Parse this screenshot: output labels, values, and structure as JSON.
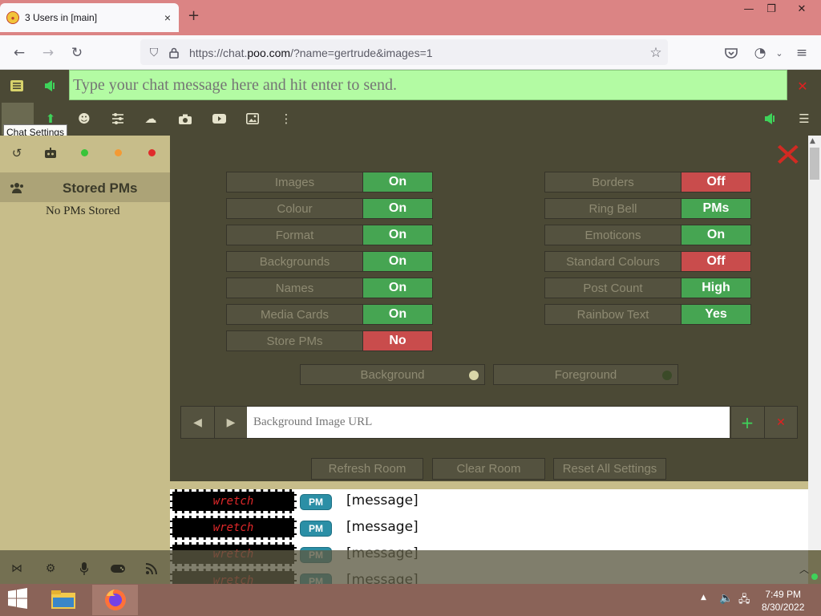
{
  "browser": {
    "tab_title": "3 Users in [main]",
    "tab_close": "×",
    "new_tab": "+",
    "url_prefix": "https://chat.",
    "url_domain": "poo.com",
    "url_rest": "/?name=gertrude&images=1",
    "window_min": "—",
    "window_restore": "❐",
    "window_close": "✕"
  },
  "chat_input": {
    "placeholder": "Type your chat message here and hit enter to send.",
    "close": "✕"
  },
  "tooltip": "Chat Settings",
  "left_panel": {
    "stored_title": "Stored PMs",
    "empty_text": "No PMs Stored"
  },
  "settings": {
    "close_label": "✕",
    "left_column": [
      {
        "label": "Images",
        "value": "On",
        "state": "on"
      },
      {
        "label": "Colour",
        "value": "On",
        "state": "on"
      },
      {
        "label": "Format",
        "value": "On",
        "state": "on"
      },
      {
        "label": "Backgrounds",
        "value": "On",
        "state": "on"
      },
      {
        "label": "Names",
        "value": "On",
        "state": "on"
      },
      {
        "label": "Media Cards",
        "value": "On",
        "state": "on"
      },
      {
        "label": "Store PMs",
        "value": "No",
        "state": "off"
      }
    ],
    "right_column": [
      {
        "label": "Borders",
        "value": "Off",
        "state": "off"
      },
      {
        "label": "Ring Bell",
        "value": "PMs",
        "state": "on"
      },
      {
        "label": "Emoticons",
        "value": "On",
        "state": "on"
      },
      {
        "label": "Standard Colours",
        "value": "Off",
        "state": "off"
      },
      {
        "label": "Post Count",
        "value": "High",
        "state": "on"
      },
      {
        "label": "Rainbow Text",
        "value": "Yes",
        "state": "on"
      }
    ],
    "background_label": "Background",
    "background_color": "#d9d6a8",
    "foreground_label": "Foreground",
    "foreground_color": "#3b4a28",
    "bg_url_placeholder": "Background Image URL",
    "prev": "◀",
    "next": "▶",
    "add": "+",
    "remove": "✕",
    "refresh_room": "Refresh Room",
    "clear_room": "Clear Room",
    "reset_all": "Reset All Settings"
  },
  "messages": [
    {
      "user": "wretch",
      "pm": "PM",
      "text": "[message]"
    },
    {
      "user": "wretch",
      "pm": "PM",
      "text": "[message]"
    },
    {
      "user": "wretch",
      "pm": "PM",
      "text": "[message]"
    },
    {
      "user": "wretch",
      "pm": "PM",
      "text": "[message]"
    }
  ],
  "taskbar": {
    "time": "7:49 PM",
    "date": "8/30/2022"
  },
  "colors": {
    "panel": "#4b4935",
    "on": "#46a552",
    "off": "#c94c4c",
    "input": "#b3fba3"
  }
}
